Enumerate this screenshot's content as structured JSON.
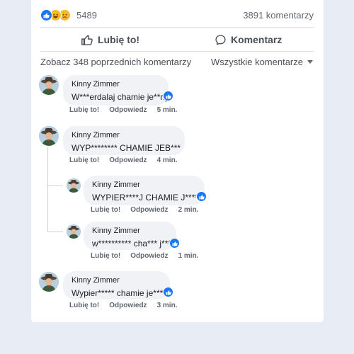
{
  "post": {
    "reaction_count": "5489",
    "comment_count": "3891 komentarzy",
    "like_action": "Lubię to!",
    "comment_action": "Komentarz",
    "previous_comments": "Zobacz 348 poprzednich komentarzy",
    "filter": "Wszystkie komentarze"
  },
  "comments": [
    {
      "author": "Kinny Zimmer",
      "text": "W***erdalaj chamie je**ny",
      "like": "Lubię to!",
      "reply": "Odpowiedz",
      "time": "5 min."
    },
    {
      "author": "Kinny Zimmer",
      "text": "WYP******** CHAMIE JEB***",
      "like": "Lubię to!",
      "reply": "Odpowiedz",
      "time": "4 min."
    },
    {
      "author": "Kinny Zimmer",
      "text": "WYPIER****J CHAMIE J****Y",
      "like": "Lubię to!",
      "reply": "Odpowiedz",
      "time": "2 min."
    },
    {
      "author": "Kinny Zimmer",
      "text": "w********** cha*** j*****",
      "like": "Lubię to!",
      "reply": "Odpowiedz",
      "time": "1 min."
    },
    {
      "author": "Kinny Zimmer",
      "text": "Wypier***** chamie je*****",
      "like": "Lubię to!",
      "reply": "Odpowiedz",
      "time": "3 min."
    }
  ],
  "colors": {
    "brand": "#1877f2",
    "bubble": "#f0f2f5",
    "page_bg": "#e8edf5"
  },
  "icons": [
    "like-icon",
    "haha-icon",
    "sad-icon",
    "thumbs-up-outline-icon",
    "comment-bubble-icon",
    "chevron-down-icon"
  ]
}
